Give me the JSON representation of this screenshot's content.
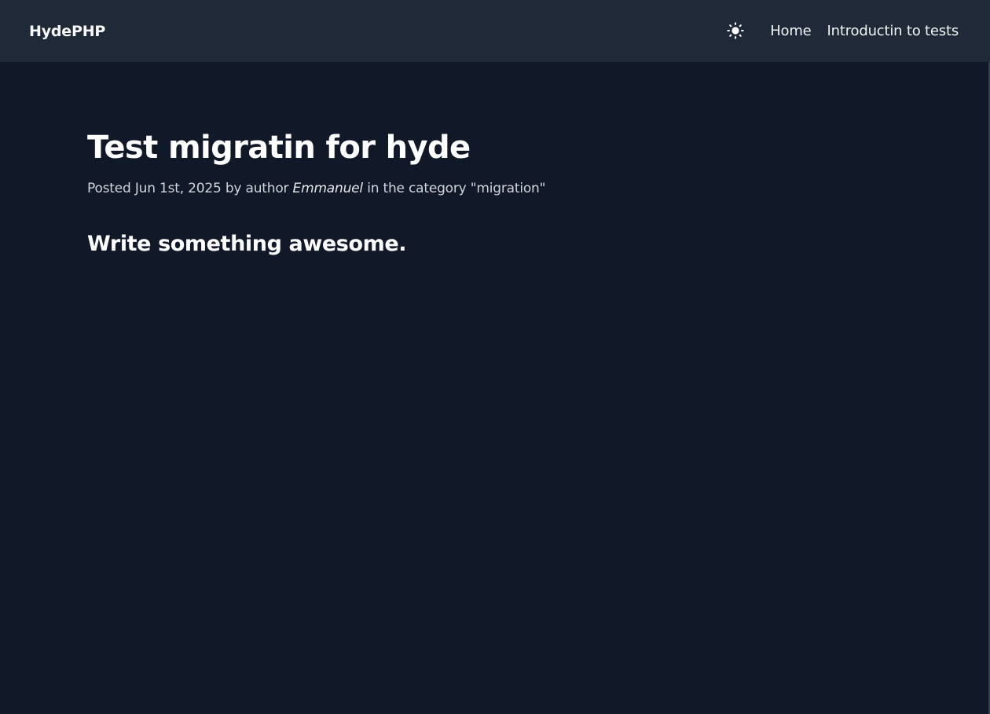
{
  "navbar": {
    "brand": "HydePHP",
    "theme_icon": "sun-icon",
    "links": [
      {
        "label": "Home"
      },
      {
        "label": "Introductin to tests"
      }
    ]
  },
  "post": {
    "title": "Test migratin for hyde",
    "meta": {
      "prefix": "Posted",
      "date": "Jun 1st, 2025",
      "by_text": "by author",
      "author": "Emmanuel",
      "category_text": "in the category",
      "category": "\"migration\""
    },
    "body_heading": "Write something awesome."
  },
  "colors": {
    "background": "#111827",
    "navbar": "#1f2937",
    "text": "#ffffff",
    "muted_text": "#d1d5db"
  }
}
